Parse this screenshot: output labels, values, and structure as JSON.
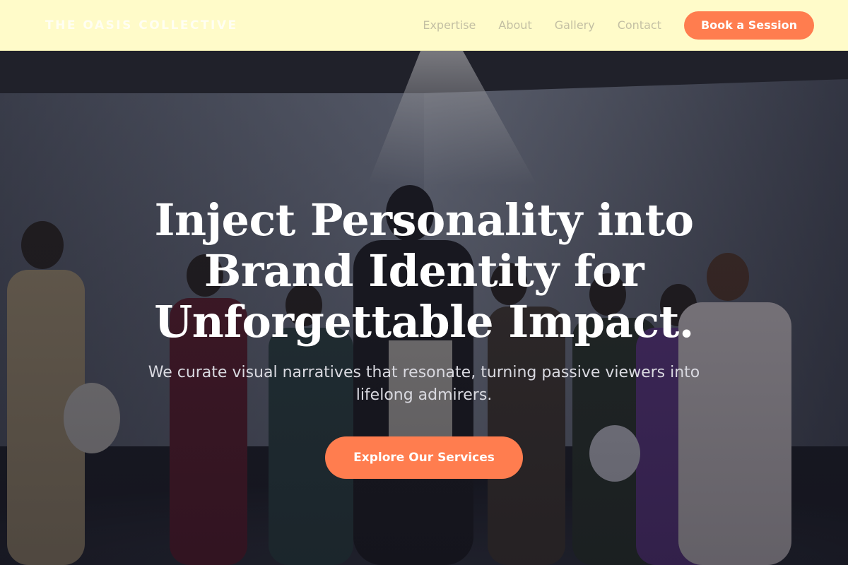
{
  "brand": {
    "name": "THE OASIS COLLECTIVE"
  },
  "nav": {
    "links": [
      "Expertise",
      "About",
      "Gallery",
      "Contact"
    ],
    "cta_label": "Book a Session"
  },
  "hero": {
    "title": "Inject Personality into Brand Identity for Unforgettable Impact.",
    "subtitle": "We curate visual narratives that resonate, turning passive viewers into lifelong admirers.",
    "cta_label": "Explore Our Services"
  },
  "colors": {
    "nav_background": "#fffbc9",
    "accent": "#ff7d4f",
    "hero_text": "#ffffff"
  }
}
